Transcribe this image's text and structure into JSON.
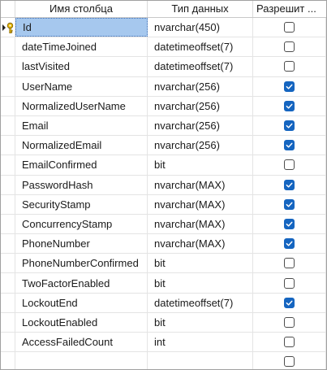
{
  "columns": {
    "name": "Имя столбца",
    "type": "Тип данных",
    "nullable": "Разрешит ..."
  },
  "rows": [
    {
      "name": "Id",
      "type": "nvarchar(450)",
      "nullable": false,
      "primary_key": true
    },
    {
      "name": "dateTimeJoined",
      "type": "datetimeoffset(7)",
      "nullable": false
    },
    {
      "name": "lastVisited",
      "type": "datetimeoffset(7)",
      "nullable": false
    },
    {
      "name": "UserName",
      "type": "nvarchar(256)",
      "nullable": true
    },
    {
      "name": "NormalizedUserName",
      "type": "nvarchar(256)",
      "nullable": true
    },
    {
      "name": "Email",
      "type": "nvarchar(256)",
      "nullable": true
    },
    {
      "name": "NormalizedEmail",
      "type": "nvarchar(256)",
      "nullable": true
    },
    {
      "name": "EmailConfirmed",
      "type": "bit",
      "nullable": false
    },
    {
      "name": "PasswordHash",
      "type": "nvarchar(MAX)",
      "nullable": true
    },
    {
      "name": "SecurityStamp",
      "type": "nvarchar(MAX)",
      "nullable": true
    },
    {
      "name": "ConcurrencyStamp",
      "type": "nvarchar(MAX)",
      "nullable": true
    },
    {
      "name": "PhoneNumber",
      "type": "nvarchar(MAX)",
      "nullable": true
    },
    {
      "name": "PhoneNumberConfirmed",
      "type": "bit",
      "nullable": false
    },
    {
      "name": "TwoFactorEnabled",
      "type": "bit",
      "nullable": false
    },
    {
      "name": "LockoutEnd",
      "type": "datetimeoffset(7)",
      "nullable": true
    },
    {
      "name": "LockoutEnabled",
      "type": "bit",
      "nullable": false
    },
    {
      "name": "AccessFailedCount",
      "type": "int",
      "nullable": false
    },
    {
      "name": "",
      "type": "",
      "nullable": false
    }
  ],
  "icons": {
    "primary_key": "key-icon",
    "row_pointer": "arrow-right-icon",
    "checked": "checkmark-icon"
  },
  "colors": {
    "selection": "#a6c8ee",
    "checkbox_on": "#1565c0"
  }
}
